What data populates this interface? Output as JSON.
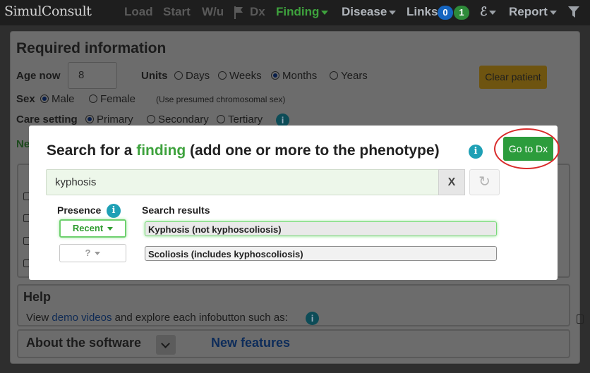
{
  "navbar": {
    "logo": "SimulConsult",
    "items": [
      "Load",
      "Start",
      "W/u",
      "Dx",
      "Finding",
      "Disease",
      "Links",
      "Report"
    ],
    "links_badges": [
      "0",
      "1"
    ],
    "dna_glyph": "ℰ"
  },
  "required": {
    "title": "Required information",
    "age_label": "Age now",
    "age_value": "8",
    "units_label": "Units",
    "units_options": [
      "Days",
      "Weeks",
      "Months",
      "Years"
    ],
    "units_selected": "Months",
    "clear_patient": "Clear patient",
    "sex_label": "Sex",
    "sex_options": [
      "Male",
      "Female"
    ],
    "sex_selected": "Male",
    "sex_note": "(Use presumed chromosomal sex)",
    "care_label": "Care setting",
    "care_options": [
      "Primary",
      "Secondary",
      "Tertiary"
    ],
    "care_selected": "Primary",
    "partial_label": "Ne"
  },
  "help": {
    "title": "Help",
    "text_prefix": "View ",
    "link": "demo videos",
    "text_suffix": " and explore each infobutton such as:"
  },
  "about": {
    "title": "About the software",
    "new_features": "New features"
  },
  "modal": {
    "title_prefix": "Search for a ",
    "title_accent": "finding",
    "title_suffix": " (add one or more to the phenotype)",
    "go_button": "Go to Dx",
    "search_value": "kyphosis",
    "clear_button": "X",
    "refresh_icon": "↻",
    "presence_header": "Presence",
    "results_header": "Search results",
    "rows": [
      {
        "presence": "Recent",
        "result": "Kyphosis (not kyphoscoliosis)"
      },
      {
        "presence": "?",
        "result": "Scoliosis (includes kyphoscoliosis)"
      }
    ]
  },
  "colors": {
    "accent_green": "#3ea23d",
    "go_button": "#2c9c3c",
    "info_teal": "#1ea0b5",
    "annotation_red": "#d92b2b"
  }
}
